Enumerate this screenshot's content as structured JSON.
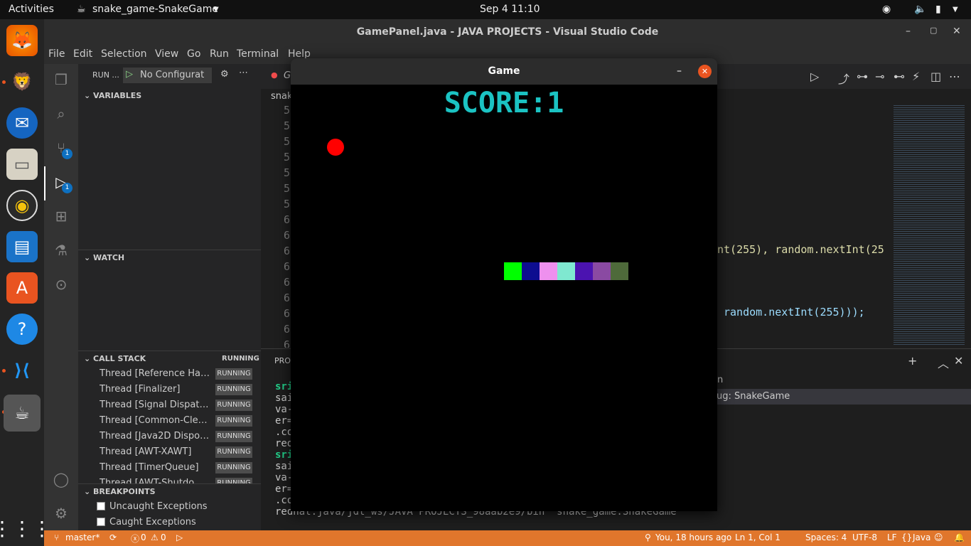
{
  "topbar": {
    "activities": "Activities",
    "app": "snake_game-SnakeGame",
    "clock": "Sep 4  11:10"
  },
  "window_title": "GamePanel.java - JAVA PROJECTS - Visual Studio Code",
  "menu": [
    "File",
    "Edit",
    "Selection",
    "View",
    "Go",
    "Run",
    "Terminal",
    "Help"
  ],
  "run": {
    "label": "RUN ...",
    "config": "No Configurati"
  },
  "badges": {
    "scm": "1",
    "debug": "1"
  },
  "sections": {
    "variables": "VARIABLES",
    "watch": "WATCH",
    "callstack": "CALL STACK",
    "callstack_state": "RUNNING",
    "breakpoints": "BREAKPOINTS"
  },
  "threads": [
    {
      "name": "Thread [Reference Han...",
      "state": "RUNNING"
    },
    {
      "name": "Thread [Finalizer]",
      "state": "RUNNING"
    },
    {
      "name": "Thread [Signal Dispatch...",
      "state": "RUNNING"
    },
    {
      "name": "Thread [Common-Clean...",
      "state": "RUNNING"
    },
    {
      "name": "Thread [Java2D Disposer]",
      "state": "RUNNING"
    },
    {
      "name": "Thread [AWT-XAWT]",
      "state": "RUNNING"
    },
    {
      "name": "Thread [TimerQueue]",
      "state": "RUNNING"
    },
    {
      "name": "Thread [AWT-Shutdown]",
      "state": "RUNNING"
    }
  ],
  "breakpoints": [
    "Uncaught Exceptions",
    "Caught Exceptions"
  ],
  "editor": {
    "tab_partial": "G",
    "breadcrumb_partial": "snak",
    "line_numbers": [
      "5",
      "5",
      "5",
      "5",
      "5",
      "5",
      "5",
      "6",
      "6",
      "6",
      "6",
      "6",
      "6",
      "6",
      "6",
      "6"
    ],
    "code_line1": "nt(255), random.nextInt(25",
    "code_line2": "random.nextInt(255)));"
  },
  "panel": {
    "tab_partial": "PRO",
    "debug_target": "ug: SnakeGame",
    "dropdown_partial": "n",
    "terminal": [
      "sri",
      "sai",
      "va-",
      "er=",
      ".co",
      "red",
      "sri",
      "sai",
      "va-",
      "er=",
      ".co",
      "redhat.java/jdt_ws/JAVA PROJECTS_98aab2e9/bin  snake_game.SnakeGame"
    ]
  },
  "status": {
    "branch": "master*",
    "errors": "0",
    "warnings": "0",
    "blame": "You, 18 hours ago",
    "position": "Ln 1, Col 1",
    "spaces": "Spaces: 4",
    "encoding": "UTF-8",
    "eol": "LF",
    "language": "Java"
  },
  "game": {
    "title": "Game",
    "score_text": "SCORE:1",
    "score_color": "#1bc3c3",
    "apple_color": "#ff0000",
    "snake_colors": [
      "#00ff00",
      "#0d0d90",
      "#ee90ee",
      "#7fe8d0",
      "#4b13b0",
      "#8a4aa2",
      "#4e6a3a"
    ]
  },
  "colors": {
    "status_bar": "#e0762c",
    "accent": "#0e70c0"
  }
}
